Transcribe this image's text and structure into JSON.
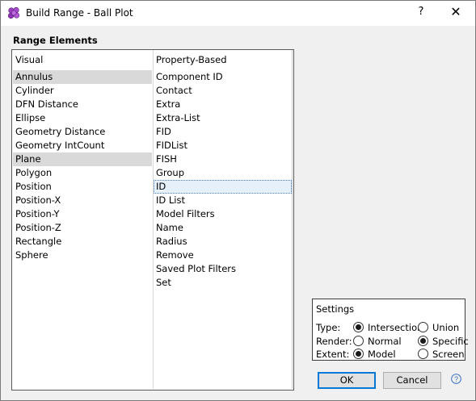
{
  "window": {
    "title": "Build Range - Ball Plot",
    "help_label": "?",
    "close_label": "✕"
  },
  "range_elements": {
    "title": "Range Elements",
    "visual_header": "Visual",
    "property_header": "Property-Based",
    "visual_items": [
      "Annulus",
      "Cylinder",
      "DFN Distance",
      "Ellipse",
      "Geometry Distance",
      "Geometry IntCount",
      "Plane",
      "Polygon",
      "Position",
      "Position-X",
      "Position-Y",
      "Position-Z",
      "Rectangle",
      "Sphere"
    ],
    "property_items": [
      "Component ID",
      "Contact",
      "Extra",
      "Extra-List",
      "FID",
      "FIDList",
      "FISH",
      "Group",
      "ID",
      "ID List",
      "Model Filters",
      "Name",
      "Radius",
      "Remove",
      "Saved Plot Filters",
      "Set"
    ],
    "visual_selected": [
      "Annulus",
      "Plane"
    ],
    "property_focused": "ID"
  },
  "settings": {
    "title": "Settings",
    "type": {
      "label": "Type:",
      "options": [
        "Intersection",
        "Union"
      ],
      "selected": "Intersection"
    },
    "render": {
      "label": "Render:",
      "options": [
        "Normal",
        "Specific"
      ],
      "selected": "Specific"
    },
    "extent": {
      "label": "Extent:",
      "options": [
        "Model",
        "Screen"
      ],
      "selected": "Model"
    }
  },
  "buttons": {
    "ok": "OK",
    "cancel": "Cancel"
  },
  "icons": {
    "app": "ball-cluster-icon",
    "help": "help-circle-icon"
  },
  "colors": {
    "selection": "#d9d9d9",
    "focus_border": "#4a7fc1",
    "ok_border": "#0078d7",
    "app_icon": "#9b3fbf"
  }
}
